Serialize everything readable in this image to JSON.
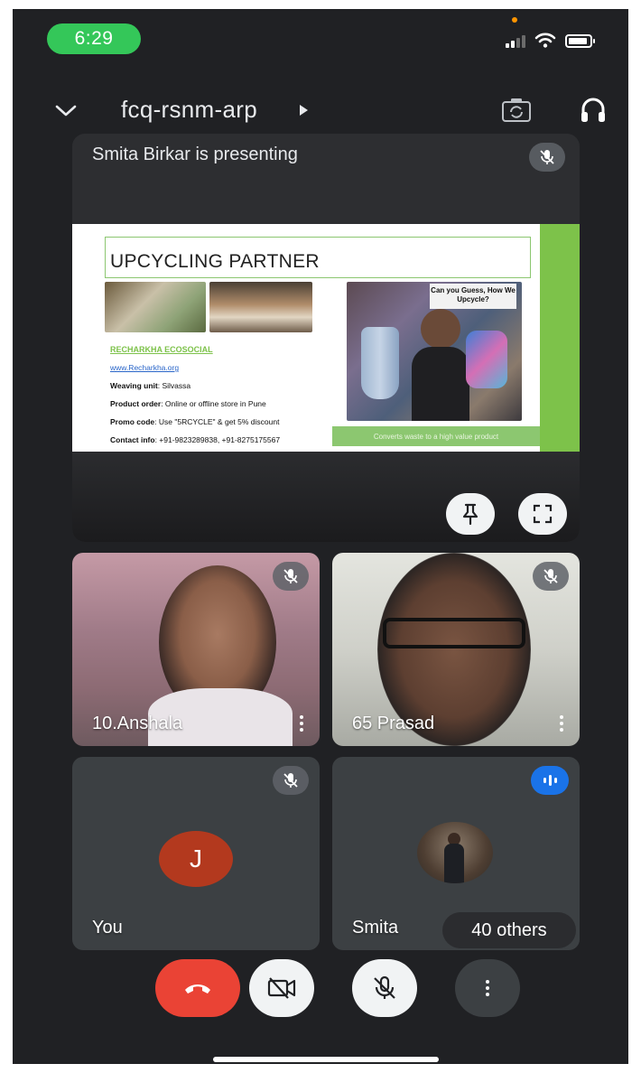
{
  "status_bar": {
    "time": "6:29",
    "time_pill_color": "#34c759",
    "privacy_indicator_color": "#ff9500",
    "icons": [
      "signal-icon",
      "wifi-icon",
      "battery-icon"
    ]
  },
  "top_bar": {
    "meeting_code": "fcq-rsnm-arp",
    "icons": [
      "chevron-down-icon",
      "meeting-details-arrow-icon",
      "camera-flip-icon",
      "headphones-icon"
    ]
  },
  "presentation": {
    "label": "Smita Birkar is presenting",
    "mic_muted": true,
    "slide": {
      "title": "UPCYCLING PARTNER",
      "photo_caption": "Can you Guess, How We Upcycle?",
      "brand": "RECHARKHA ECOSOCIAL",
      "website": "www.Recharkha.org",
      "weaving_unit_label": "Weaving unit",
      "weaving_unit_value": ": Silvassa",
      "product_order_label": "Product order",
      "product_order_value": ": Online or offline store in Pune",
      "promo_code_label": "Promo code",
      "promo_code_value": ": Use \"5RCYCLE\" & get 5% discount",
      "contact_label": "Contact info",
      "contact_value": ": +91-9823289838, +91-8275175567",
      "tagline": "Converts waste to a high value product",
      "accent_color": "#7dc24a"
    },
    "actions": [
      "pin-icon",
      "fullscreen-icon"
    ]
  },
  "participants": [
    {
      "name": "10.Anshala",
      "mic_muted": true,
      "video": true
    },
    {
      "name": "65 Prasad",
      "mic_muted": true,
      "video": true
    },
    {
      "name": "You",
      "avatar_initial": "J",
      "avatar_color": "#b3391e",
      "mic_muted": true,
      "video": false
    },
    {
      "name": "Smita",
      "others_count": "40 others",
      "speaking": true,
      "speaking_color": "#1a73e8",
      "video": false
    }
  ],
  "controls": {
    "end_call_color": "#ea4335",
    "camera_off": true,
    "mic_muted": true,
    "icons": [
      "end-call-icon",
      "camera-off-icon",
      "mic-off-icon",
      "more-options-icon"
    ]
  }
}
